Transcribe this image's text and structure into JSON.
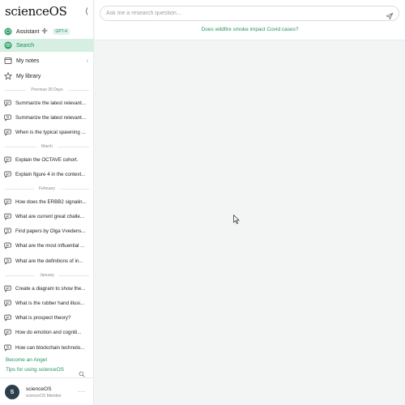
{
  "brand": "scienceOS",
  "collapse_glyph": "⟨",
  "nav": {
    "assistant": "Assistant",
    "model_badge": "GPT-4",
    "search": "Search",
    "notes": "My notes",
    "library": "My library"
  },
  "sections": {
    "previous30": "Previous 30 Days",
    "march": "March",
    "february": "February",
    "january": "January"
  },
  "history": {
    "previous30": [
      {
        "icon": "chat-icon",
        "text": "Summarize the latest relevant..."
      },
      {
        "icon": "search-chat-icon",
        "text": "Summarize the latest relevant..."
      },
      {
        "icon": "chat-icon",
        "text": "When is the typical spawning ..."
      }
    ],
    "march": [
      {
        "icon": "chat-icon",
        "text": "Explain the OCTAVE cohort."
      },
      {
        "icon": "chat-icon",
        "text": "Explain figure 4 in the context..."
      }
    ],
    "february": [
      {
        "icon": "chat-icon",
        "text": "How does the ERBB2 signalin..."
      },
      {
        "icon": "chat-icon",
        "text": "What are current great challe..."
      },
      {
        "icon": "search-chat-icon",
        "text": "Find papers by Olga Vvedens..."
      },
      {
        "icon": "chat-icon",
        "text": "What are the most influential ..."
      },
      {
        "icon": "search-chat-icon",
        "text": "What are the definitions of in..."
      }
    ],
    "january": [
      {
        "icon": "chat-icon",
        "text": "Create a diagram to show the..."
      },
      {
        "icon": "chat-icon",
        "text": "What is the rubber hand illusi..."
      },
      {
        "icon": "chat-icon",
        "text": "What is prospect theory?"
      },
      {
        "icon": "chat-icon",
        "text": "How do emotion and cogniti..."
      },
      {
        "icon": "search-chat-icon",
        "text": "How can blockchain technolo..."
      }
    ]
  },
  "footer": {
    "angel": "Become an Angel",
    "tips": "Tips for using scienceOS"
  },
  "user": {
    "initial": "S",
    "name": "scienceOS",
    "role": "scienceOS Member",
    "menu": "···"
  },
  "search": {
    "placeholder": "Ask me a research question...",
    "value": "",
    "suggestion": "Does wildfire smoke impact Covid cases?"
  },
  "colors": {
    "accent": "#23955e",
    "active_bg": "#d6efe2",
    "main_bg": "#f3f5f5"
  }
}
